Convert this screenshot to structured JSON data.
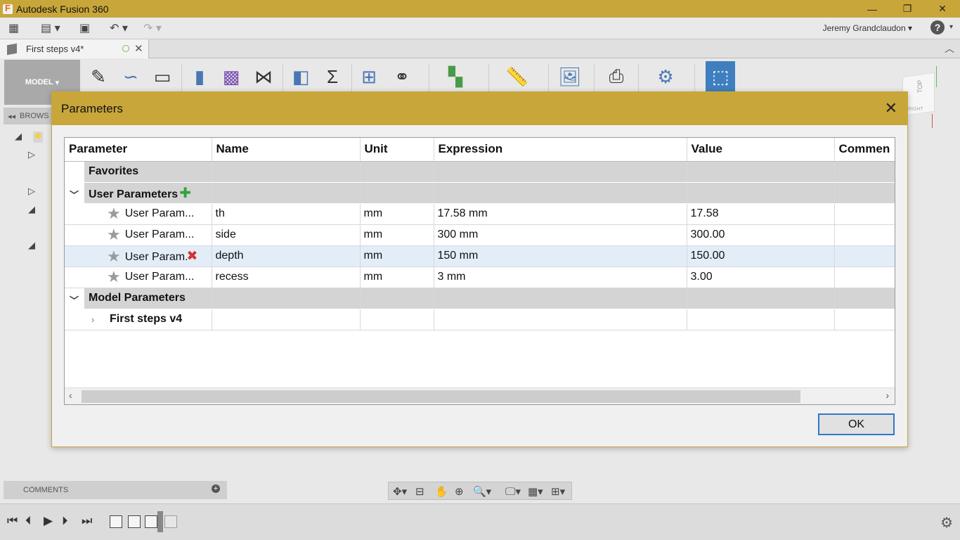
{
  "window": {
    "title": "Autodesk Fusion 360",
    "minimize": "—",
    "maximize": "❐",
    "close": "✕"
  },
  "toolbar": {
    "user_name": "Jeremy Grandclaudon",
    "help": "?"
  },
  "document_tab": {
    "title": "First steps v4*"
  },
  "ribbon": {
    "workspace": "MODEL"
  },
  "browser": {
    "label": "BROWS"
  },
  "viewcube": {
    "top": "TOP",
    "right": "RIGHT"
  },
  "dialog": {
    "title": "Parameters",
    "ok_label": "OK",
    "columns": [
      "Parameter",
      "Name",
      "Unit",
      "Expression",
      "Value",
      "Commen"
    ],
    "groups": {
      "favorites": "Favorites",
      "user_parameters": "User Parameters",
      "model_parameters": "Model Parameters",
      "model_child": "First steps v4"
    },
    "user_rows": [
      {
        "param": "User Param...",
        "name": "th",
        "unit": "mm",
        "expression": "17.58 mm",
        "value": "17.58",
        "comment": ""
      },
      {
        "param": "User Param...",
        "name": "side",
        "unit": "mm",
        "expression": "300 mm",
        "value": "300.00",
        "comment": ""
      },
      {
        "param": "User Param.",
        "name": "depth",
        "unit": "mm",
        "expression": "150 mm",
        "value": "150.00",
        "comment": ""
      },
      {
        "param": "User Param...",
        "name": "recess",
        "unit": "mm",
        "expression": "3 mm",
        "value": "3.00",
        "comment": ""
      }
    ]
  },
  "comments": {
    "label": "COMMENTS"
  },
  "colors": {
    "title_bar": "#c9a63a",
    "selection": "#e2edf8",
    "accent": "#2f78c8"
  }
}
